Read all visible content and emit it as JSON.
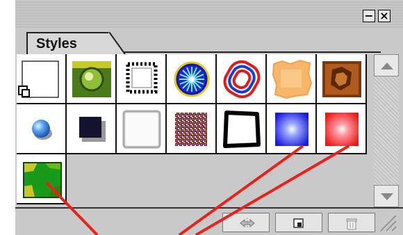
{
  "window": {
    "minimize_glyph": "−",
    "close_glyph": "×"
  },
  "panel": {
    "tab_label": "Styles",
    "menu_icon": "triangle-right-icon"
  },
  "styles": [
    {
      "name": "default-style-swatch",
      "icon": "no-style-icon"
    },
    {
      "name": "green-bevel-swatch",
      "icon": "green-gem-icon"
    },
    {
      "name": "dotted-frame-swatch",
      "icon": "dotted-frame-icon"
    },
    {
      "name": "blue-star-swatch",
      "icon": "blue-star-icon"
    },
    {
      "name": "red-blue-rings-swatch",
      "icon": "rings-icon"
    },
    {
      "name": "orange-rough-swatch",
      "icon": "rough-edge-icon"
    },
    {
      "name": "wood-texture-swatch",
      "icon": "wood-texture-icon"
    },
    {
      "name": "blue-bubble-swatch",
      "icon": "bubble-icon"
    },
    {
      "name": "navy-drop-shadow-swatch",
      "icon": "drop-shadow-icon"
    },
    {
      "name": "white-emboss-swatch",
      "icon": "emboss-icon"
    },
    {
      "name": "noise-texture-swatch",
      "icon": "noise-icon"
    },
    {
      "name": "black-frame-swatch",
      "icon": "black-frame-icon"
    },
    {
      "name": "blue-glow-swatch",
      "icon": "blue-glow-icon"
    },
    {
      "name": "red-glow-swatch",
      "icon": "red-glow-icon"
    },
    {
      "name": "green-camo-swatch",
      "icon": "camo-icon"
    }
  ],
  "bottom_bar": {
    "buttons": [
      "clear-style-icon",
      "new-style-icon",
      "trash-icon"
    ]
  },
  "colors": {
    "panel_bg": "#c9c9c9",
    "annotation_line": "#e8211a"
  }
}
